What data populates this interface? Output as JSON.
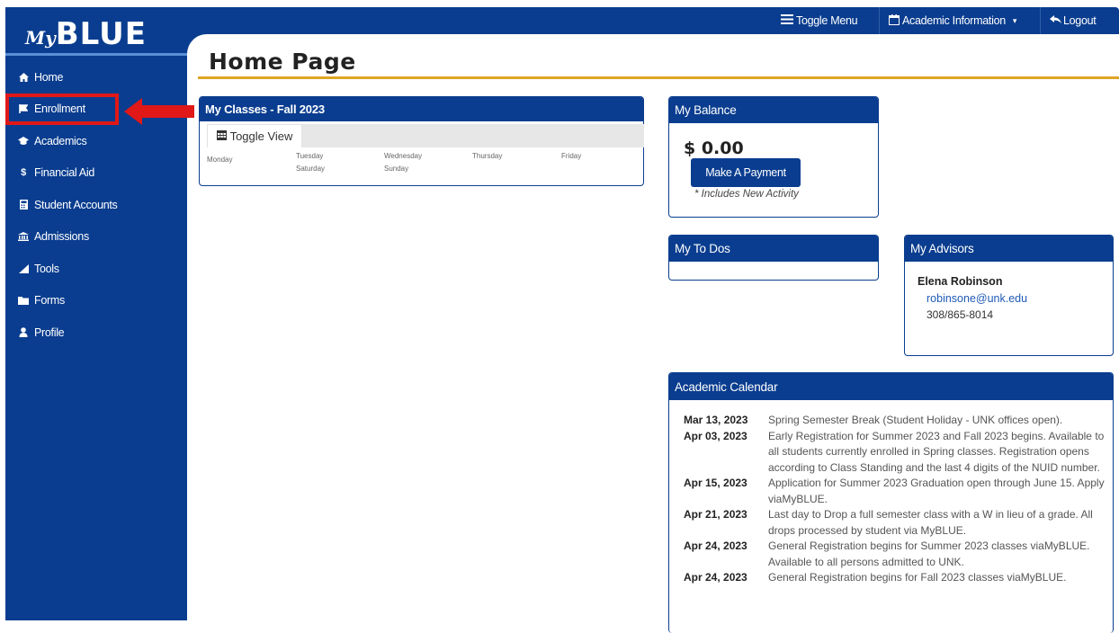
{
  "app": {
    "logo_prefix": "My",
    "logo_main": "BLUE"
  },
  "topbar": {
    "toggle_menu": "Toggle Menu",
    "academic_info": "Academic Information",
    "logout": "Logout"
  },
  "sidebar": {
    "items": [
      {
        "label": "Home",
        "icon": "home-icon"
      },
      {
        "label": "Enrollment",
        "icon": "flag-icon"
      },
      {
        "label": "Academics",
        "icon": "graduation-cap-icon"
      },
      {
        "label": "Financial Aid",
        "icon": "dollar-icon"
      },
      {
        "label": "Student Accounts",
        "icon": "calculator-icon"
      },
      {
        "label": "Admissions",
        "icon": "institution-icon"
      },
      {
        "label": "Tools",
        "icon": "wrench-icon"
      },
      {
        "label": "Forms",
        "icon": "folder-icon"
      },
      {
        "label": "Profile",
        "icon": "user-icon"
      }
    ]
  },
  "page": {
    "title": "Home Page"
  },
  "classes": {
    "title": "My Classes - Fall 2023",
    "toggle_view": "Toggle View",
    "days": [
      "Monday",
      "Tuesday",
      "Wednesday",
      "Thursday",
      "Friday",
      "Saturday",
      "Sunday"
    ]
  },
  "balance": {
    "title": "My Balance",
    "amount": "$ 0.00",
    "pay_button": "Make A Payment",
    "note": "* Includes New Activity"
  },
  "todos": {
    "title": "My To Dos"
  },
  "advisors": {
    "title": "My Advisors",
    "name": "Elena Robinson",
    "email": "robinsone@unk.edu",
    "phone": "308/865-8014"
  },
  "calendar": {
    "title": "Academic Calendar",
    "events": [
      {
        "date": "Mar 13, 2023",
        "text": "Spring Semester Break (Student Holiday - UNK offices open)."
      },
      {
        "date": "Apr 03, 2023",
        "text": "Early Registration for Summer 2023 and Fall 2023 begins. Available to all students currently enrolled in Spring classes. Registration opens according to Class Standing and the last 4 digits of the NUID number."
      },
      {
        "date": "Apr 15, 2023",
        "text": "Application for Summer 2023 Graduation open through June 15. Apply viaMyBLUE."
      },
      {
        "date": "Apr 21, 2023",
        "text": "Last day to Drop a full semester class with a W in lieu of a grade. All drops processed by student via MyBLUE."
      },
      {
        "date": "Apr 24, 2023",
        "text": "General Registration begins for Summer 2023 classes viaMyBLUE. Available to all persons admitted to UNK."
      },
      {
        "date": "Apr 24, 2023",
        "text": "General Registration begins for Fall 2023 classes viaMyBLUE."
      }
    ]
  },
  "colors": {
    "brand": "#0a3d8f",
    "accent": "#e0a526",
    "highlight": "#e01818"
  }
}
